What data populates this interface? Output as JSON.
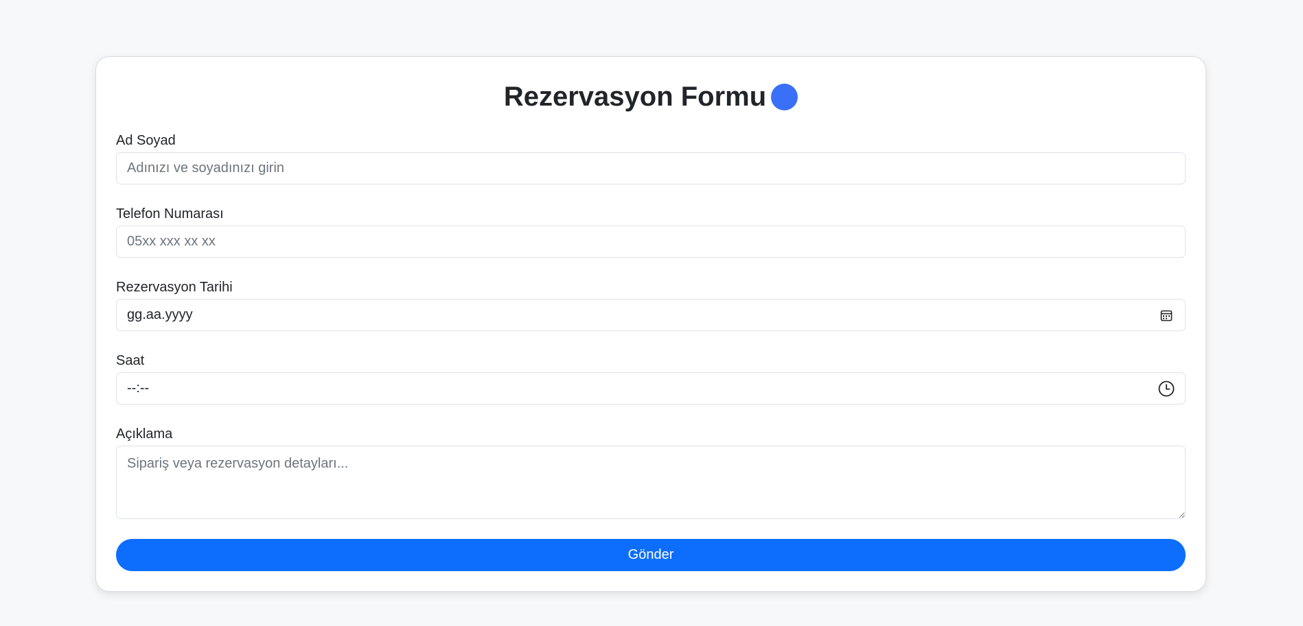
{
  "form": {
    "title": "Rezervasyon Formu",
    "title_badge_color": "#3a6ff8",
    "fields": {
      "name": {
        "label": "Ad Soyad",
        "placeholder": "Adınızı ve soyadınızı girin",
        "value": ""
      },
      "phone": {
        "label": "Telefon Numarası",
        "placeholder": "05xx xxx xx xx",
        "value": ""
      },
      "date": {
        "label": "Rezervasyon Tarihi",
        "display": "gg.aa.yyyy",
        "icon": "calendar-icon"
      },
      "time": {
        "label": "Saat",
        "display": "--:--",
        "icon": "clock-icon"
      },
      "description": {
        "label": "Açıklama",
        "placeholder": "Sipariş veya rezervasyon detayları...",
        "value": ""
      }
    },
    "submit_label": "Gönder",
    "accent_color": "#0d6efd"
  }
}
